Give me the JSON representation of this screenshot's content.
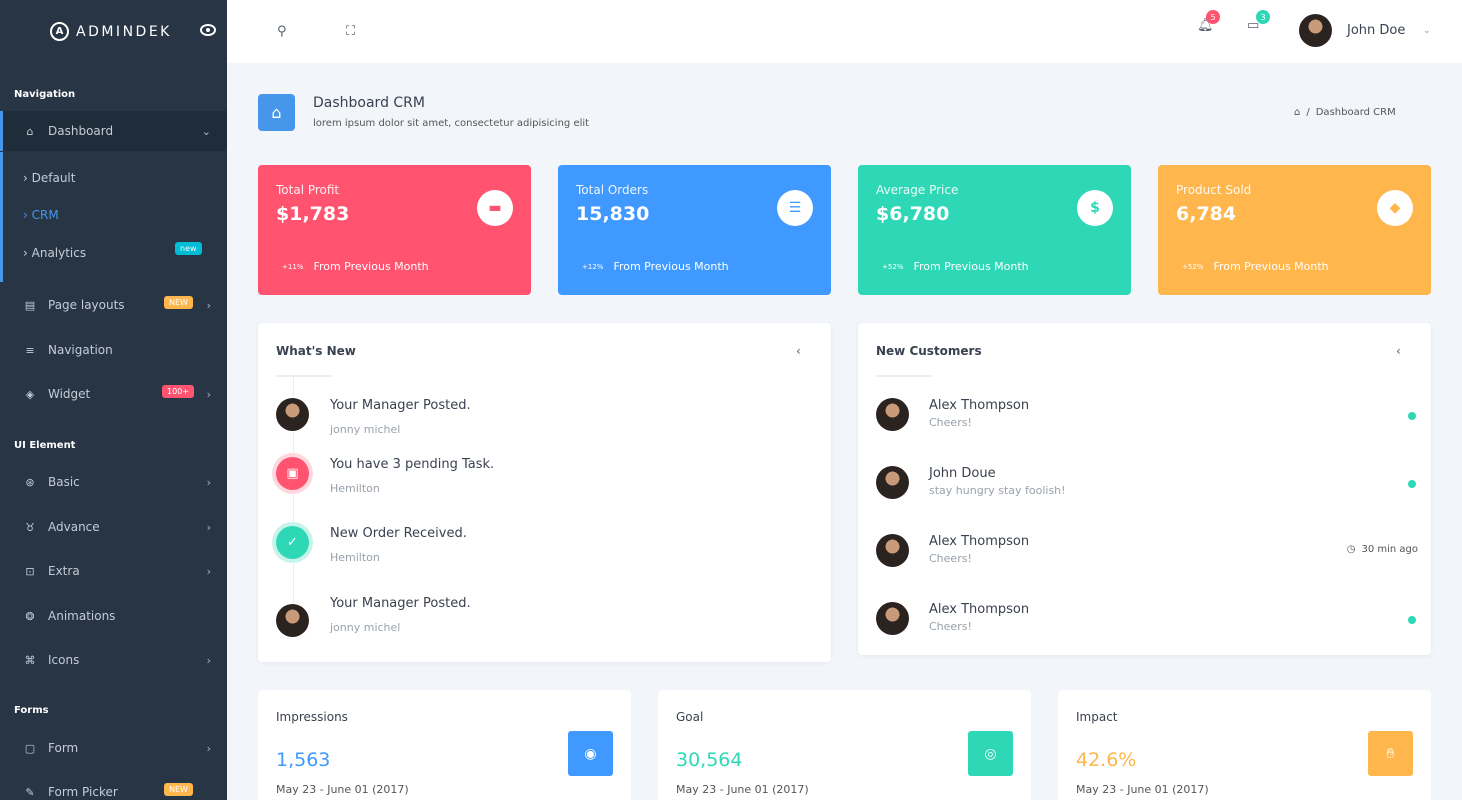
{
  "brand": {
    "name": "ADMINDEK"
  },
  "sidebar": {
    "sections": {
      "navigation": "Navigation",
      "ui_element": "UI Element",
      "forms": "Forms"
    },
    "items": [
      {
        "label": "Dashboard",
        "icon": "home-icon"
      },
      {
        "label": "Page layouts",
        "badge": "NEW"
      },
      {
        "label": "Navigation"
      },
      {
        "label": "Widget",
        "badge": "100+"
      },
      {
        "label": "Basic"
      },
      {
        "label": "Advance"
      },
      {
        "label": "Extra"
      },
      {
        "label": "Animations"
      },
      {
        "label": "Icons"
      },
      {
        "label": "Form"
      },
      {
        "label": "Form Picker",
        "badge": "NEW"
      }
    ],
    "sub": [
      {
        "label": "Default"
      },
      {
        "label": "CRM"
      },
      {
        "label": "Analytics",
        "badge": "new"
      }
    ]
  },
  "header": {
    "notif_count": "5",
    "msg_count": "3",
    "user_name": "John Doe"
  },
  "page": {
    "title": "Dashboard CRM",
    "subtitle": "lorem ipsum dolor sit amet, consectetur adipisicing elit",
    "breadcrumb": "Dashboard CRM"
  },
  "stats": [
    {
      "label": "Total Profit",
      "value": "$1,783",
      "pct": "+11%",
      "foot": "From Previous Month",
      "color": "#ff5370",
      "icon": "money-icon"
    },
    {
      "label": "Total Orders",
      "value": "15,830",
      "pct": "+12%",
      "foot": "From Previous Month",
      "color": "#4099ff",
      "icon": "database-icon"
    },
    {
      "label": "Average Price",
      "value": "$6,780",
      "pct": "+52%",
      "foot": "From Previous Month",
      "color": "#2ed8b6",
      "icon": "dollar-icon"
    },
    {
      "label": "Product Sold",
      "value": "6,784",
      "pct": "+52%",
      "foot": "From Previous Month",
      "color": "#ffb64d",
      "icon": "tag-icon"
    }
  ],
  "whats_new": {
    "title": "What's New",
    "items": [
      {
        "title": "Your Manager Posted.",
        "sub": "jonny michel"
      },
      {
        "title": "You have 3 pending Task.",
        "sub": "Hemilton"
      },
      {
        "title": "New Order Received.",
        "sub": "Hemilton"
      },
      {
        "title": "Your Manager Posted.",
        "sub": "jonny michel"
      }
    ]
  },
  "customers": {
    "title": "New Customers",
    "items": [
      {
        "name": "Alex Thompson",
        "status": "Cheers!"
      },
      {
        "name": "John Doue",
        "status": "stay hungry stay foolish!"
      },
      {
        "name": "Alex Thompson",
        "status": "Cheers!",
        "time": "30 min ago"
      },
      {
        "name": "Alex Thompson",
        "status": "Cheers!"
      }
    ]
  },
  "bottom": [
    {
      "label": "Impressions",
      "value": "1,563",
      "date": "May 23 - June 01 (2017)",
      "color": "#4099ff"
    },
    {
      "label": "Goal",
      "value": "30,564",
      "date": "May 23 - June 01 (2017)",
      "color": "#2ed8b6"
    },
    {
      "label": "Impact",
      "value": "42.6%",
      "date": "May 23 - June 01 (2017)",
      "color": "#ffb64d"
    }
  ]
}
